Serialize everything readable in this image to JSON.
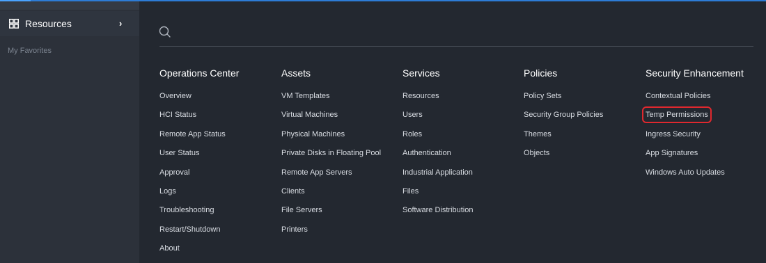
{
  "sidebar": {
    "resources_label": "Resources",
    "favorites_label": "My Favorites"
  },
  "menu": {
    "columns": [
      {
        "title": "Operations Center",
        "items": [
          "Overview",
          "HCI Status",
          "Remote App Status",
          "User Status",
          "Approval",
          "Logs",
          "Troubleshooting",
          "Restart/Shutdown",
          "About"
        ]
      },
      {
        "title": "Assets",
        "items": [
          "VM Templates",
          "Virtual Machines",
          "Physical Machines",
          "Private Disks in Floating Pool",
          "Remote App Servers",
          "Clients",
          "File Servers",
          "Printers"
        ]
      },
      {
        "title": "Services",
        "items": [
          "Resources",
          "Users",
          "Roles",
          "Authentication",
          "Industrial Application",
          "Files",
          "Software Distribution"
        ]
      },
      {
        "title": "Policies",
        "items": [
          "Policy Sets",
          "Security Group Policies",
          "Themes",
          "Objects"
        ]
      },
      {
        "title": "Security Enhancement",
        "items": [
          "Contextual Policies",
          "Temp Permissions",
          "Ingress Security",
          "App Signatures",
          "Windows Auto Updates"
        ]
      }
    ],
    "highlighted_item": "Temp Permissions"
  },
  "icons": {
    "resources": "grid-icon",
    "expand": "chevron-right-icon",
    "search": "search-icon"
  },
  "colors": {
    "background": "#232830",
    "sidebar": "#2c313a",
    "accent": "#2d7cd6",
    "highlight_border": "#e0282e"
  }
}
